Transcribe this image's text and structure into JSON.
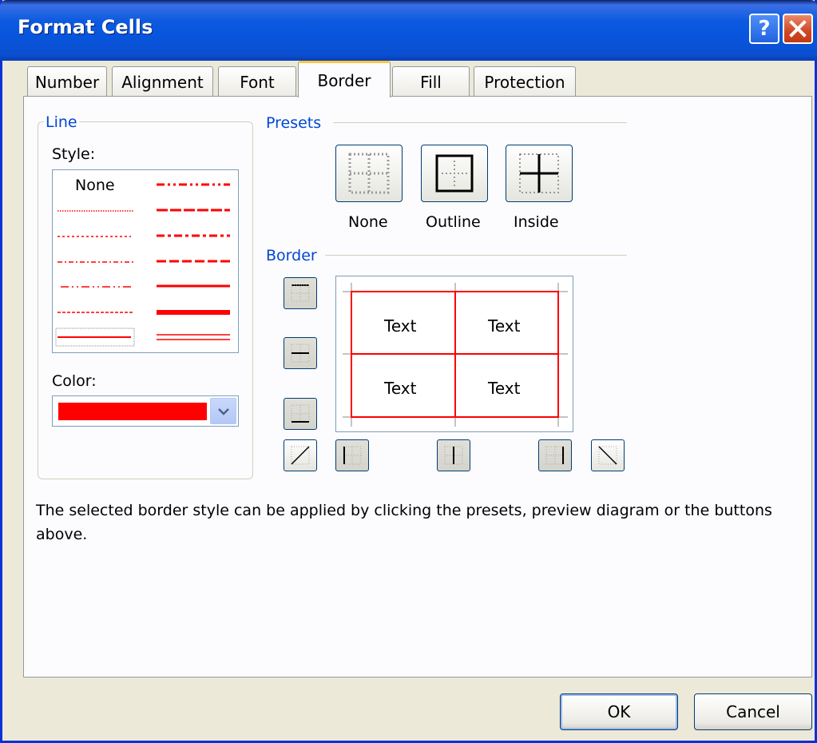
{
  "window": {
    "title": "Format Cells"
  },
  "title_buttons": {
    "help": "?",
    "close": "close-icon"
  },
  "tabs": [
    {
      "label": "Number",
      "active": false
    },
    {
      "label": "Alignment",
      "active": false
    },
    {
      "label": "Font",
      "active": false
    },
    {
      "label": "Border",
      "active": true
    },
    {
      "label": "Fill",
      "active": false
    },
    {
      "label": "Protection",
      "active": false
    }
  ],
  "line_group": {
    "label": "Line",
    "style_label": "Style:",
    "style_none": "None",
    "color_label": "Color:",
    "color_value": "#ff0000"
  },
  "presets": {
    "label": "Presets",
    "none_label": "None",
    "outline_label": "Outline",
    "inside_label": "Inside"
  },
  "border": {
    "label": "Border",
    "preview_cells": [
      "Text",
      "Text",
      "Text",
      "Text"
    ],
    "line_color": "#ff0000"
  },
  "description": "The selected border style can be applied by clicking the presets, preview diagram or the buttons above.",
  "buttons": {
    "ok": "OK",
    "cancel": "Cancel"
  }
}
